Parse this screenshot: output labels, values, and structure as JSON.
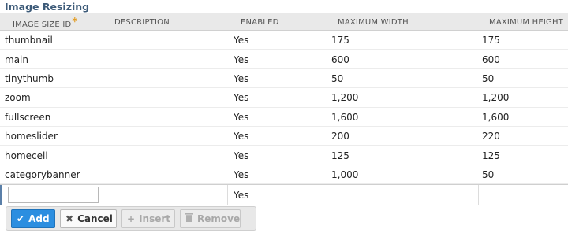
{
  "title": "Image Resizing",
  "columns": {
    "id": "IMAGE SIZE ID",
    "required_marker": "*",
    "description": "DESCRIPTION",
    "enabled": "ENABLED",
    "max_width": "MAXIMUM WIDTH",
    "max_height": "MAXIMUM HEIGHT"
  },
  "rows": [
    {
      "id": "thumbnail",
      "description": "",
      "enabled": "Yes",
      "max_width": "175",
      "max_height": "175"
    },
    {
      "id": "main",
      "description": "",
      "enabled": "Yes",
      "max_width": "600",
      "max_height": "600"
    },
    {
      "id": "tinythumb",
      "description": "",
      "enabled": "Yes",
      "max_width": "50",
      "max_height": "50"
    },
    {
      "id": "zoom",
      "description": "",
      "enabled": "Yes",
      "max_width": "1,200",
      "max_height": "1,200"
    },
    {
      "id": "fullscreen",
      "description": "",
      "enabled": "Yes",
      "max_width": "1,600",
      "max_height": "1,600"
    },
    {
      "id": "homeslider",
      "description": "",
      "enabled": "Yes",
      "max_width": "200",
      "max_height": "220"
    },
    {
      "id": "homecell",
      "description": "",
      "enabled": "Yes",
      "max_width": "125",
      "max_height": "125"
    },
    {
      "id": "categorybanner",
      "description": "",
      "enabled": "Yes",
      "max_width": "1,000",
      "max_height": "50"
    }
  ],
  "new_row": {
    "id_value": "",
    "enabled": "Yes"
  },
  "toolbar": {
    "add_label": "Add",
    "cancel_label": "Cancel",
    "insert_label": "Insert",
    "remove_label": "Remove"
  },
  "colors": {
    "title": "#3c5a78",
    "required_marker": "#e39a1c",
    "add_button": "#2b8ee0",
    "row_accent": "#5a7fa8"
  }
}
